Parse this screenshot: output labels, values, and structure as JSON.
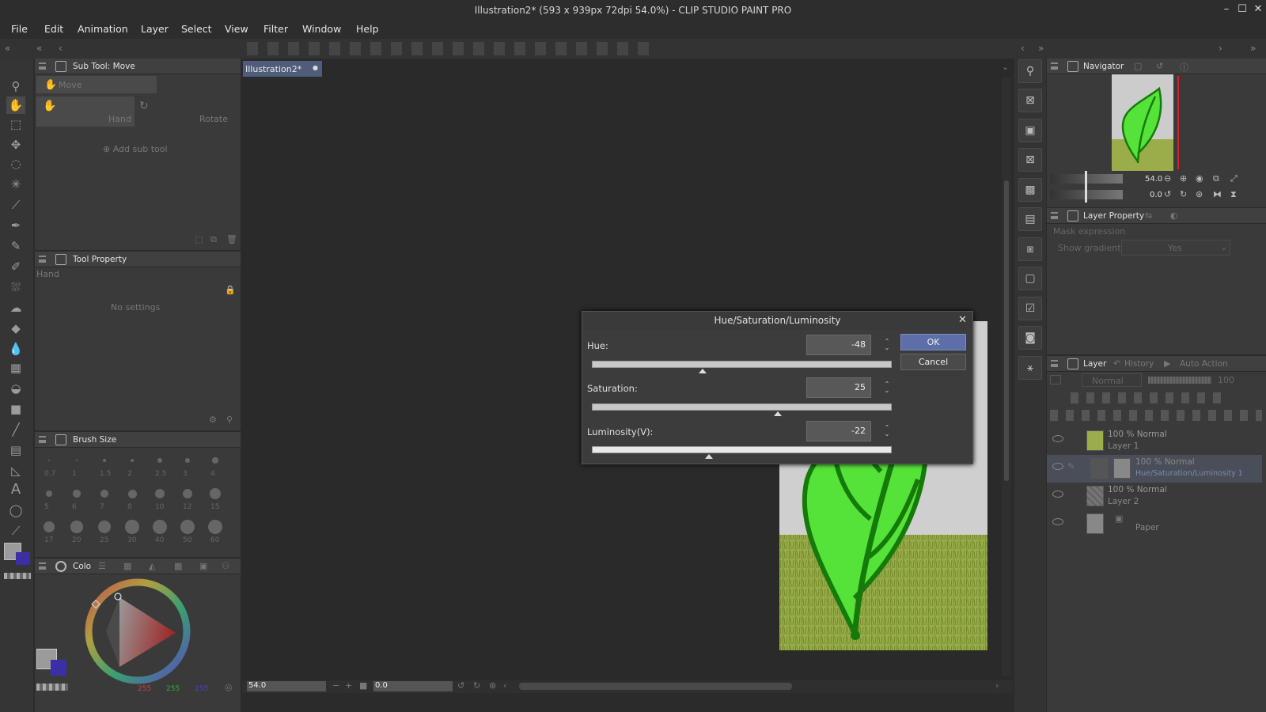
{
  "window": {
    "title": "Illustration2* (593 x 939px 72dpi 54.0%) - CLIP STUDIO PAINT PRO"
  },
  "menu": [
    "File",
    "Edit",
    "Animation",
    "Layer",
    "Select",
    "View",
    "Filter",
    "Window",
    "Help"
  ],
  "subtool": {
    "title": "Sub Tool: Move",
    "group": "Move",
    "items": [
      "Hand",
      "Rotate"
    ],
    "add": "Add sub tool"
  },
  "tool_property": {
    "title": "Tool Property",
    "tool": "Hand",
    "empty": "No settings"
  },
  "brush_size": {
    "title": "Brush Size",
    "sizes": [
      "0.7",
      "1",
      "1.5",
      "2",
      "2.5",
      "3",
      "4",
      "5",
      "6",
      "7",
      "8",
      "10",
      "12",
      "15",
      "17",
      "20",
      "25",
      "30",
      "40",
      "50",
      "60"
    ]
  },
  "color": {
    "tab": "Colo",
    "r": "255",
    "g": "255",
    "b": "255"
  },
  "canvas": {
    "tab": "Illustration2*"
  },
  "status": {
    "zoom": "54.0",
    "angle": "0.0"
  },
  "dialog": {
    "title": "Hue/Saturation/Luminosity",
    "hue_label": "Hue:",
    "hue": "-48",
    "sat_label": "Saturation:",
    "sat": "25",
    "lum_label": "Luminosity(V):",
    "lum": "-22",
    "ok": "OK",
    "cancel": "Cancel",
    "hue_level": 0.37,
    "sat_level": 0.62,
    "lum_level": 0.39
  },
  "navigator": {
    "title": "Navigator",
    "zoom": "54.0",
    "angle": "0.0"
  },
  "layer_property": {
    "title": "Layer Property",
    "mask": "Mask expression",
    "gradients_label": "Show gradients",
    "gradients_value": "Yes"
  },
  "layer_panel": {
    "tabs": [
      "Layer",
      "History",
      "Auto Action"
    ],
    "blend": "Normal",
    "opacity": "100",
    "layers": [
      {
        "line1": "100 % Normal",
        "line2": "Layer 1"
      },
      {
        "line1": "100 % Normal",
        "line2": "Hue/Saturation/Luminosity 1"
      },
      {
        "line1": "100 % Normal",
        "line2": "Layer 2"
      },
      {
        "line1": "",
        "line2": "Paper"
      }
    ]
  }
}
